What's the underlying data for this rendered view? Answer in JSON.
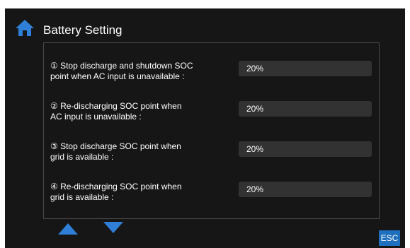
{
  "colors": {
    "screen_background": "#161616",
    "accent": "#2f7fd8",
    "value_field": "#323232",
    "panel_border": "#4a4a4a"
  },
  "header": {
    "icon": "home-icon",
    "title": "Battery Setting"
  },
  "settings": [
    {
      "label_line1": "① Stop discharge and shutdown SOC",
      "label_line2": "point when AC input is unavailable :",
      "value": "20%"
    },
    {
      "label_line1": "② Re-discharging SOC point when",
      "label_line2": "AC input is unavailable :",
      "value": "20%"
    },
    {
      "label_line1": "③ Stop discharge SOC point when",
      "label_line2": "grid is available :",
      "value": "20%"
    },
    {
      "label_line1": "④ Re-discharging SOC point when",
      "label_line2": "grid is available :",
      "value": "20%"
    }
  ],
  "footer": {
    "up_icon": "triangle-up-icon",
    "down_icon": "triangle-down-icon",
    "esc_label": "ESC"
  }
}
